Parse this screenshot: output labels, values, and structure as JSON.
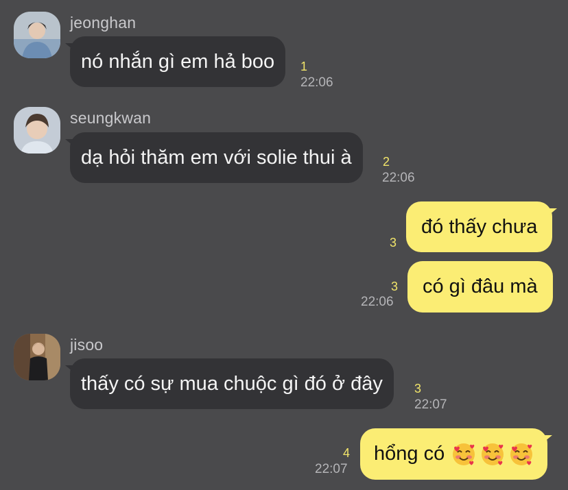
{
  "messages": [
    {
      "sender": "jeonghan",
      "text": "nó nhắn gì em hả boo",
      "unread": "1",
      "time": "22:06"
    },
    {
      "sender": "seungkwan",
      "text": "dạ hỏi thăm em với solie thui à",
      "unread": "2",
      "time": "22:06"
    },
    {
      "text": "đó thấy chưa",
      "unread": "3"
    },
    {
      "text": "có gì đâu mà",
      "unread": "3",
      "time": "22:06"
    },
    {
      "sender": "jisoo",
      "text": "thấy có sự mua chuộc gì đó ở đây",
      "unread": "3",
      "time": "22:07"
    },
    {
      "text": "hổng có",
      "emoji": [
        "smiling-face-with-hearts",
        "smiling-face-with-hearts",
        "smiling-face-with-hearts"
      ],
      "unread": "4",
      "time": "22:07"
    }
  ],
  "colors": {
    "background": "#4a4a4c",
    "incoming_bubble": "#333336",
    "outgoing_bubble": "#fbed74",
    "unread_count": "#f2e56a"
  }
}
